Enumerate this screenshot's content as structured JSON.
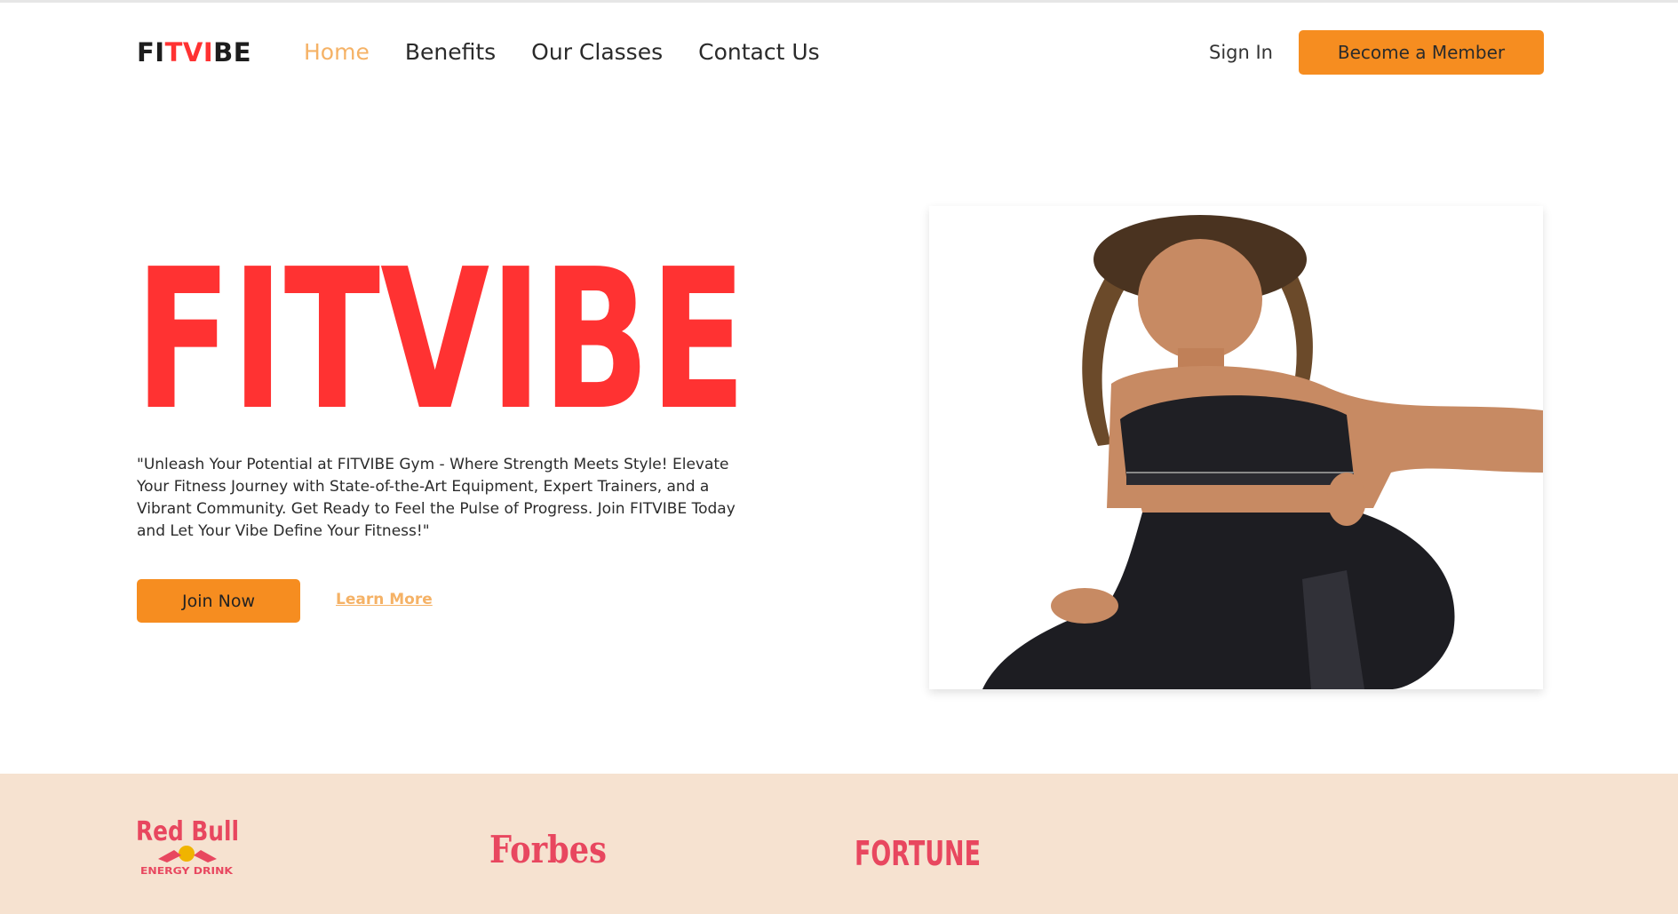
{
  "nav": {
    "logo": {
      "part1": "FI",
      "part2": "TVI",
      "part3": "BE"
    },
    "links": [
      {
        "label": "Home",
        "active": true
      },
      {
        "label": "Benefits",
        "active": false
      },
      {
        "label": "Our Classes",
        "active": false
      },
      {
        "label": "Contact Us",
        "active": false
      }
    ],
    "sign_in": "Sign In",
    "cta": "Become a Member"
  },
  "hero": {
    "title": "FITVIBE",
    "description": "\"Unleash Your Potential at FITVIBE Gym - Where Strength Meets Style! Elevate Your Fitness Journey with State-of-the-Art Equipment, Expert Trainers, and a Vibrant Community. Get Ready to Feel the Pulse of Progress. Join FITVIBE Today and Let Your Vibe Define Your Fitness!\"",
    "join_label": "Join Now",
    "learn_label": "Learn More"
  },
  "brands": {
    "redbull": {
      "name": "Red Bull",
      "sub": "ENERGY DRINK"
    },
    "forbes": "Forbes",
    "fortune": "FORTUNE"
  },
  "colors": {
    "accent": "#f68d20",
    "brand_red": "#ff3232",
    "active_link": "#f5b266",
    "strip_bg": "#f6e2d0",
    "logo_pink": "#e8475f"
  }
}
